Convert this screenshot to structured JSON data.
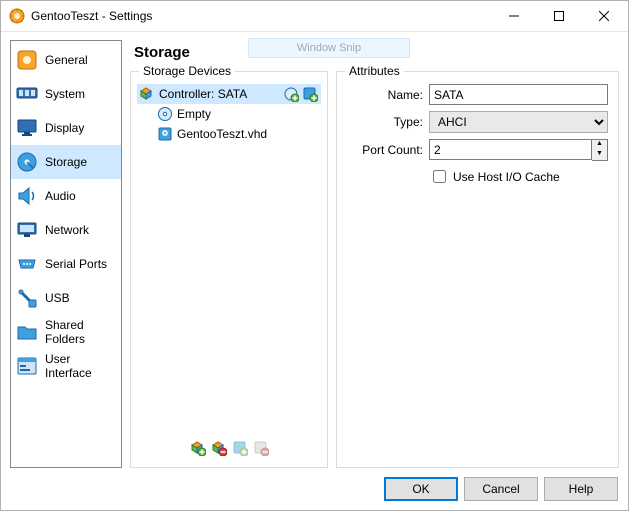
{
  "window": {
    "title": "GentooTeszt - Settings",
    "snip_label": "Window Snip"
  },
  "sidebar": {
    "items": [
      {
        "label": "General",
        "icon": "general"
      },
      {
        "label": "System",
        "icon": "system"
      },
      {
        "label": "Display",
        "icon": "display"
      },
      {
        "label": "Storage",
        "icon": "storage",
        "selected": true
      },
      {
        "label": "Audio",
        "icon": "audio"
      },
      {
        "label": "Network",
        "icon": "network"
      },
      {
        "label": "Serial Ports",
        "icon": "serial"
      },
      {
        "label": "USB",
        "icon": "usb"
      },
      {
        "label": "Shared Folders",
        "icon": "folder"
      },
      {
        "label": "User Interface",
        "icon": "ui"
      }
    ]
  },
  "page": {
    "title": "Storage",
    "devices_legend": "Storage Devices",
    "attributes_legend": "Attributes"
  },
  "tree": {
    "controller": {
      "label": "Controller: SATA",
      "selected": true,
      "children": [
        {
          "label": "Empty",
          "icon": "cd"
        },
        {
          "label": "GentooTeszt.vhd",
          "icon": "hdd"
        }
      ]
    }
  },
  "attributes": {
    "name_label": "Name:",
    "name_value": "SATA",
    "type_label": "Type:",
    "type_value": "AHCI",
    "type_options": [
      "AHCI"
    ],
    "portcount_label": "Port Count:",
    "portcount_value": "2",
    "hostio_label": "Use Host I/O Cache",
    "hostio_checked": false
  },
  "footer": {
    "ok": "OK",
    "cancel": "Cancel",
    "help": "Help"
  }
}
